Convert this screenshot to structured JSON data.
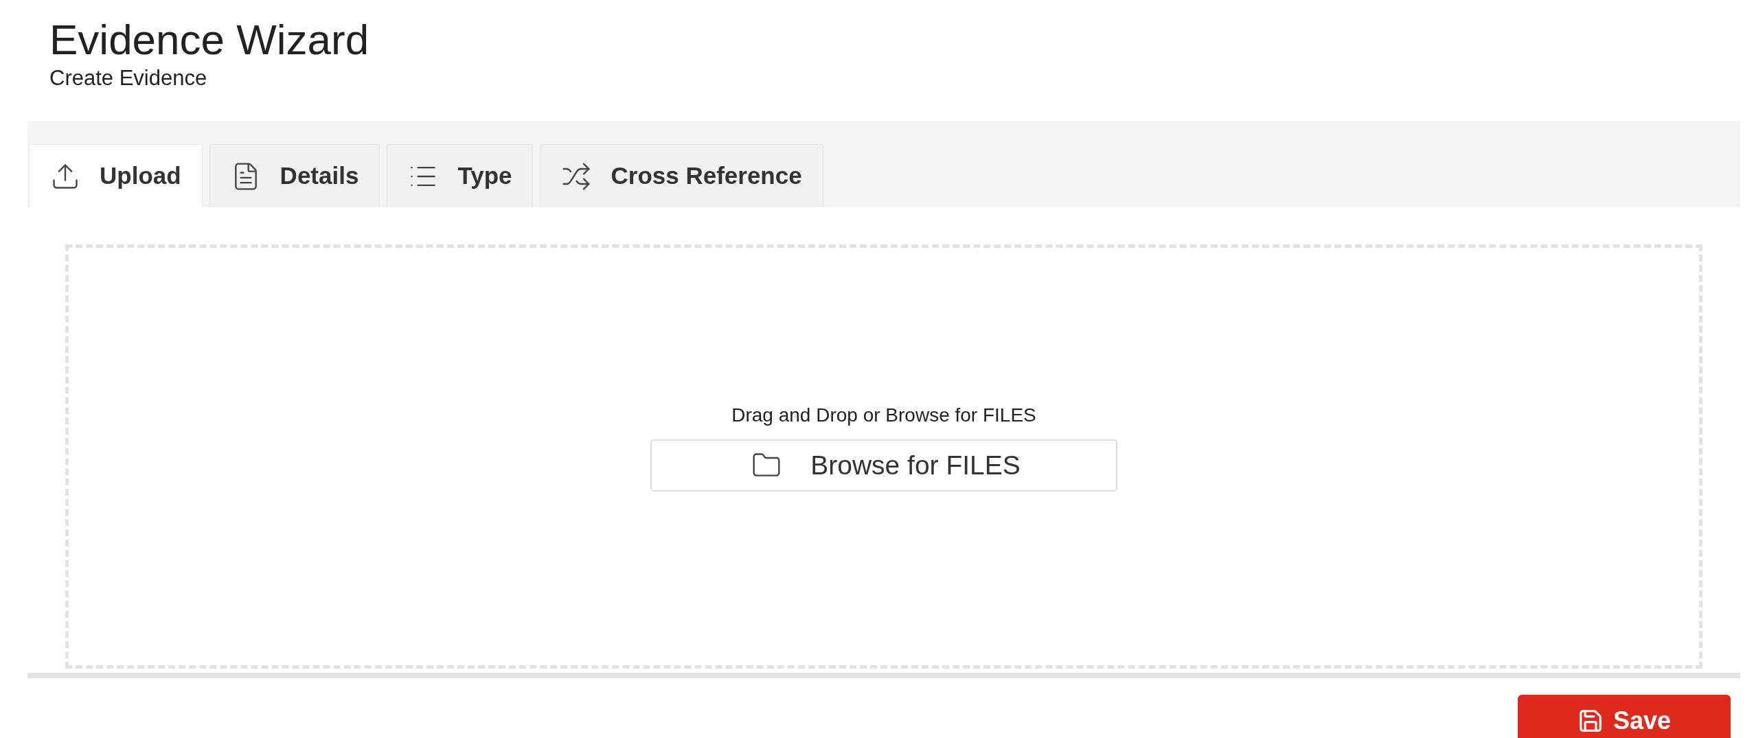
{
  "header": {
    "title": "Evidence Wizard",
    "subtitle": "Create Evidence"
  },
  "tabs": [
    {
      "label": "Upload",
      "selected": true
    },
    {
      "label": "Details",
      "selected": false
    },
    {
      "label": "Type",
      "selected": false
    },
    {
      "label": "Cross Reference",
      "selected": false
    }
  ],
  "dropzone": {
    "prompt": "Drag and Drop or Browse for FILES",
    "button": "Browse for FILES"
  },
  "save_button": "Save"
}
